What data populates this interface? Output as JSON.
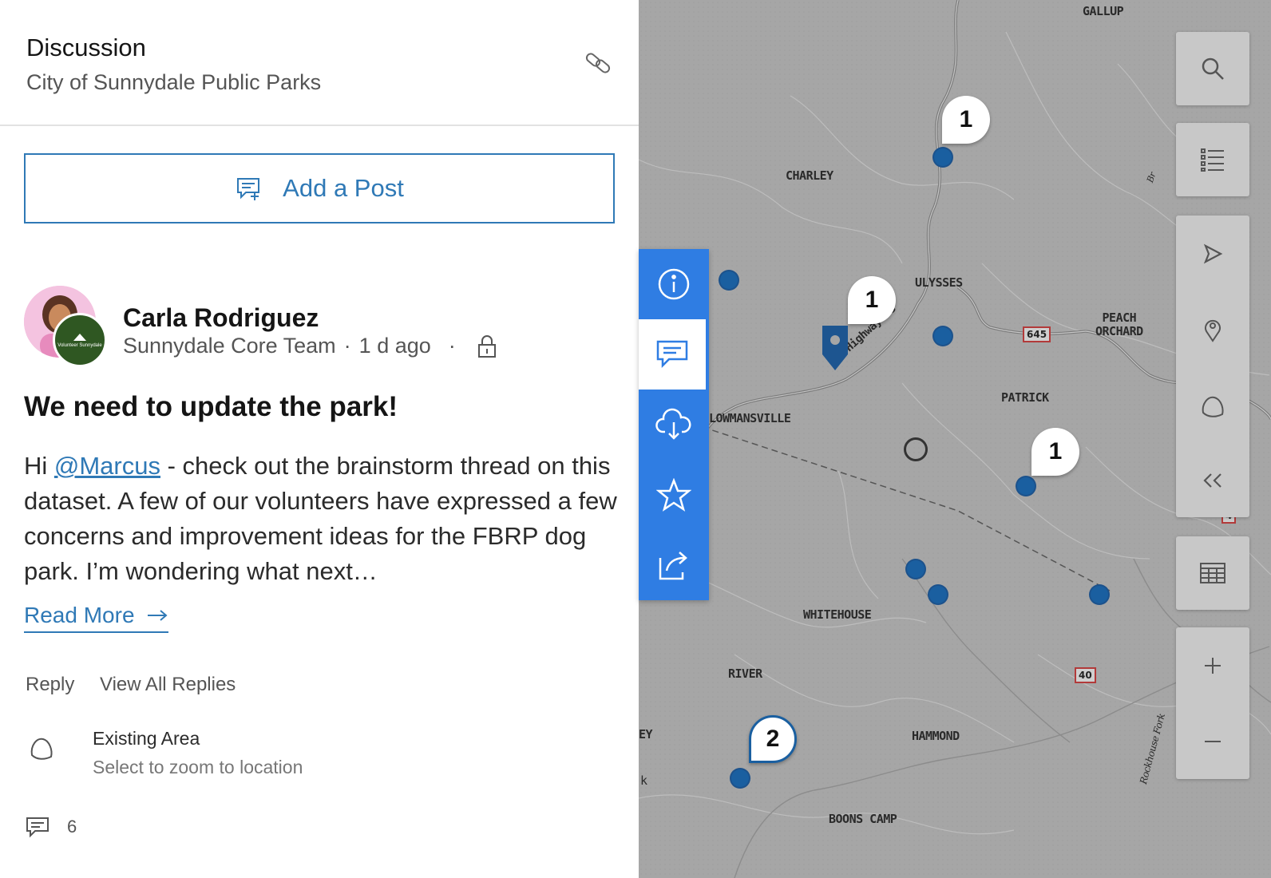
{
  "header": {
    "title": "Discussion",
    "subtitle": "City of Sunnydale Public Parks"
  },
  "add_post": {
    "label": "Add a Post"
  },
  "post": {
    "author_name": "Carla Rodriguez",
    "author_team": "Sunnydale Core Team",
    "time_ago": "1 d ago",
    "separator": "·",
    "org_badge_text": "Volunteer Sunnydale",
    "title": "We need to update the park!",
    "body_prefix": "Hi ",
    "mention": "@Marcus",
    "body_text": " - check out the brainstorm thread on this dataset. A few of our volunteers have expressed a few concerns and improvement ideas for the FBRP dog park. I’m wondering what next…",
    "read_more": "Read More",
    "reply": "Reply",
    "view_all_replies": "View All Replies",
    "area_title": "Existing Area",
    "area_subtitle": "Select to zoom to location",
    "comment_count": "6"
  },
  "map": {
    "place_labels": {
      "gallup": "GALLUP",
      "charley": "CHARLEY",
      "ulysses": "ULYSSES",
      "peach_orchard": "PEACH\nORCHARD",
      "patrick": "PATRICK",
      "lowmansville": "LOWMANSVILLE",
      "whitehouse": "WHITEHOUSE",
      "river": "RIVER",
      "hammond": "HAMMOND",
      "boons_camp": "BOONS CAMP",
      "ey": "EY",
      "k": "k"
    },
    "road_labels": {
      "highway": "US Highway 23",
      "rockhouse_fork": "Rockhouse Fork",
      "br": "Br"
    },
    "shields": {
      "r645": "645",
      "r40": "40",
      "r4": "4"
    },
    "cluster_counts": [
      "1",
      "1",
      "1",
      "2"
    ]
  },
  "colors": {
    "accent": "#2f79b6",
    "action_bar": "#2f7de3",
    "map_bg": "#a6a6a6",
    "marker": "#1a5fa0"
  },
  "icons": {
    "header_link": "link-icon",
    "add_post": "comment-add-icon",
    "lock": "lock-icon",
    "read_more": "arrow-right-icon",
    "area": "polygon-icon",
    "comments": "comment-icon",
    "actions": [
      "info-icon",
      "comment-icon",
      "cloud-download-icon",
      "star-icon",
      "share-icon"
    ],
    "tools": [
      "search-icon",
      "legend-list-icon",
      "navigate-icon",
      "pin-icon",
      "polygon-icon",
      "collapse-icon",
      "table-icon",
      "zoom-in-icon",
      "zoom-out-icon"
    ]
  }
}
